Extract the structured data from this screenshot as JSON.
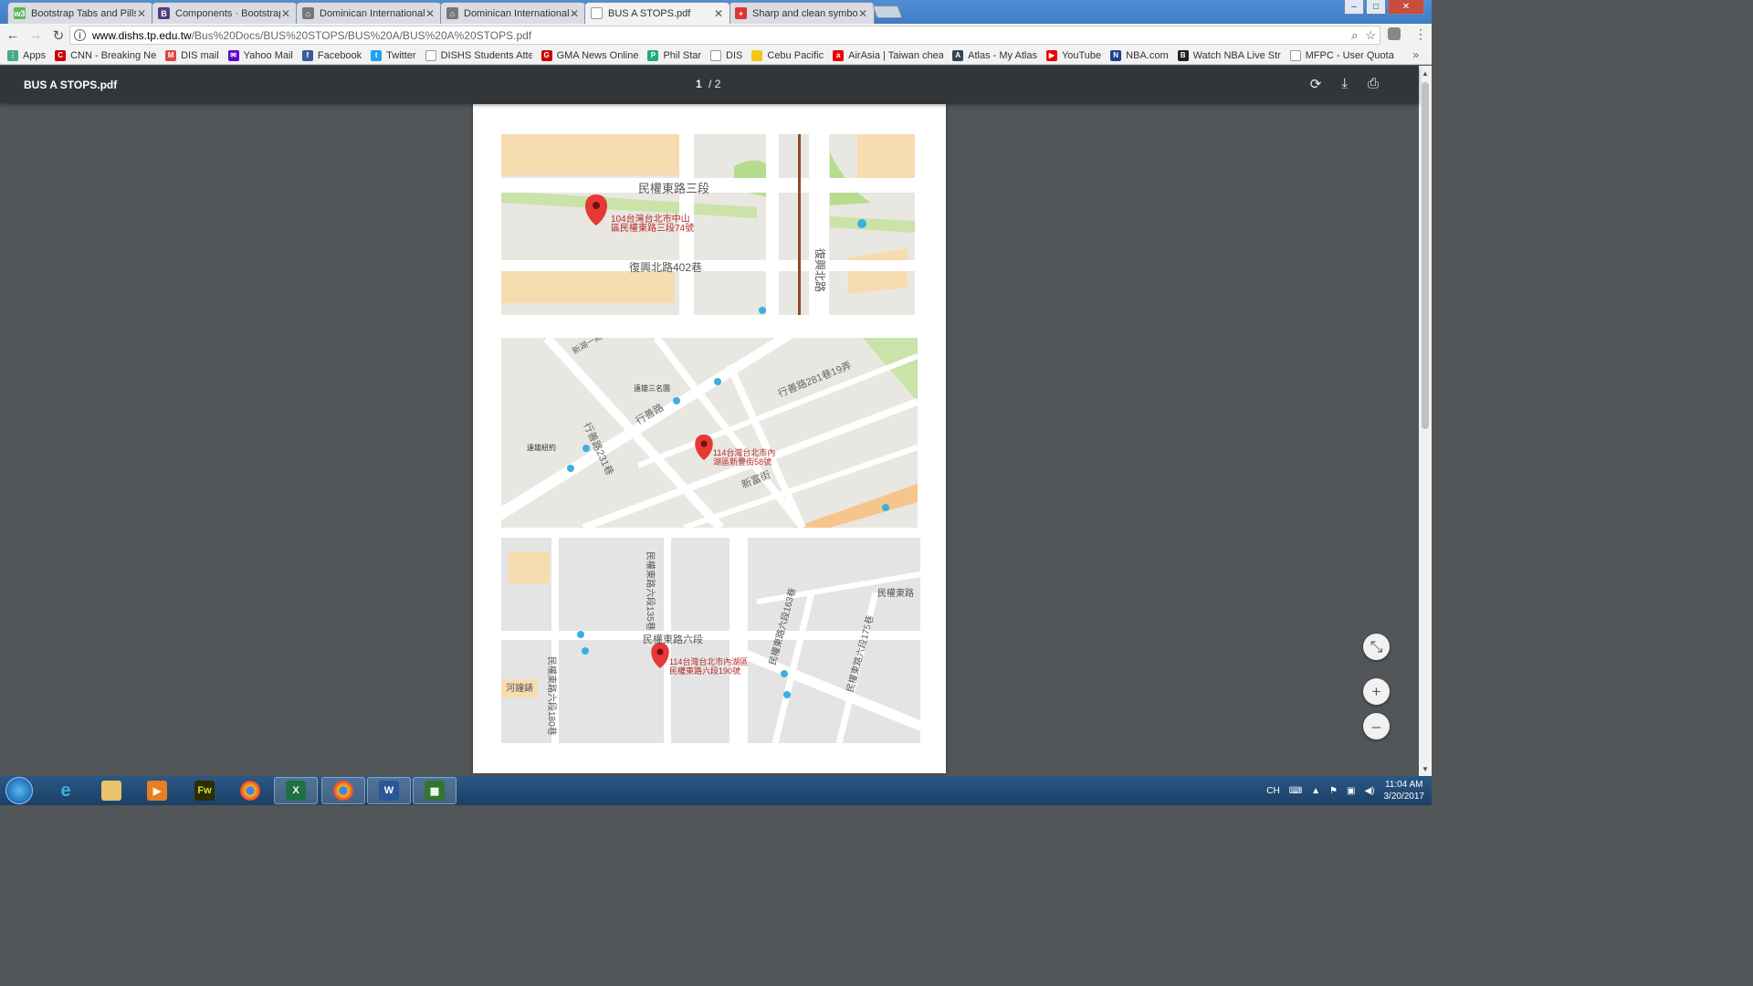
{
  "tabs": [
    {
      "title": "Bootstrap Tabs and Pills",
      "icon": "w3schools-icon",
      "color": "#5cb85c",
      "glyph": "w3"
    },
    {
      "title": "Components · Bootstrap",
      "icon": "bootstrap-icon",
      "color": "#563d7c",
      "glyph": "B"
    },
    {
      "title": "Dominican International",
      "icon": "dominican-icon",
      "color": "#777777",
      "glyph": "⌂"
    },
    {
      "title": "Dominican International",
      "icon": "dominican-icon",
      "color": "#777777",
      "glyph": "⌂"
    },
    {
      "title": "BUS A STOPS.pdf",
      "icon": "document-icon",
      "color": "#ffffff",
      "glyph": "▯"
    },
    {
      "title": "Sharp and clean symbols",
      "icon": "flag-icon",
      "color": "#d33",
      "glyph": "+"
    }
  ],
  "window_buttons": {
    "minimize": "–",
    "maximize": "□",
    "close": "✕"
  },
  "address": {
    "host": "www.dishs.tp.edu.tw",
    "path": "/Bus%20Docs/BUS%20STOPS/BUS%20A/BUS%20A%20STOPS.pdf"
  },
  "bookmarks": [
    {
      "label": "Apps",
      "icon": "apps-grid-icon",
      "color": "#e44"
    },
    {
      "label": "CNN - Breaking News",
      "icon": "cnn-icon",
      "color": "#c00"
    },
    {
      "label": "DIS mail",
      "icon": "gmail-icon",
      "color": "#d44"
    },
    {
      "label": "Yahoo Mail",
      "icon": "yahoo-mail-icon",
      "color": "#5f01d1"
    },
    {
      "label": "Facebook",
      "icon": "facebook-icon",
      "color": "#3b5998"
    },
    {
      "label": "Twitter",
      "icon": "twitter-icon",
      "color": "#1da1f2"
    },
    {
      "label": "DISHS Students Atten",
      "icon": "page-icon",
      "color": "#999999"
    },
    {
      "label": "GMA News Online",
      "icon": "gma-icon",
      "color": "#c00"
    },
    {
      "label": "Phil Star",
      "icon": "philstar-icon",
      "color": "#2a7"
    },
    {
      "label": "DIS",
      "icon": "page-icon",
      "color": "#999999"
    },
    {
      "label": "Cebu Pacific",
      "icon": "cebu-pacific-icon",
      "color": "#f5c518"
    },
    {
      "label": "AirAsia | Taiwan chea",
      "icon": "airasia-icon",
      "color": "#e00"
    },
    {
      "label": "Atlas - My Atlas",
      "icon": "atlas-icon",
      "color": "#345"
    },
    {
      "label": "YouTube",
      "icon": "youtube-icon",
      "color": "#e00"
    },
    {
      "label": "NBA.com",
      "icon": "nba-icon",
      "color": "#1d428a"
    },
    {
      "label": "Watch NBA Live Strea",
      "icon": "batman-icon",
      "color": "#222"
    },
    {
      "label": "MFPC - User Quota M",
      "icon": "page-icon",
      "color": "#999999"
    }
  ],
  "pdf": {
    "title": "BUS A STOPS.pdf",
    "current_page": "1",
    "separator": "/",
    "total_pages": "2"
  },
  "maps": [
    {
      "streets": [
        "民權東路三段",
        "復興北路402巷",
        "復興北路"
      ],
      "address": [
        "104台灣台北市中山",
        "區民權東路三段74號"
      ]
    },
    {
      "streets": [
        "行善路231巷",
        "行善路",
        "行善路281巷19弄",
        "新富街",
        "新湖一路",
        "遠雄三名園",
        "遠雄紐約"
      ],
      "address": [
        "114台灣台北市內",
        "湖區新豐街58號"
      ]
    },
    {
      "streets": [
        "民權東路六段",
        "民權東路六段180巷",
        "民權東路六段135巷",
        "民權東路六段163巷",
        "民權東路六段175巷",
        "民權東路",
        "河鐘錶"
      ],
      "address": [
        "114台灣台北市內湖區",
        "民權東路六段190號"
      ]
    }
  ],
  "zoom_controls": {
    "fit": "⤡",
    "plus": "+",
    "minus": "–"
  },
  "taskbar": {
    "apps": [
      "internet-explorer-icon",
      "file-explorer-icon",
      "media-player-icon",
      "fireworks-icon",
      "chrome-icon",
      "excel-icon",
      "chrome-icon",
      "word-icon",
      "project-icon"
    ],
    "fireworks_label": "Fw",
    "word_label": "W",
    "excel_label": "X",
    "language": "CH",
    "time": "11:04 AM",
    "date": "3/20/2017"
  },
  "colors": {
    "tab_strip": "#3f7cc4",
    "pdf_toolbar": "#323639",
    "pdf_background": "#525659",
    "map_road": "#ffffff",
    "map_land": "#e9e7e2",
    "map_park": "#c9e3a8",
    "map_major_road": "#f5d9a3",
    "marker": "#e53935"
  }
}
